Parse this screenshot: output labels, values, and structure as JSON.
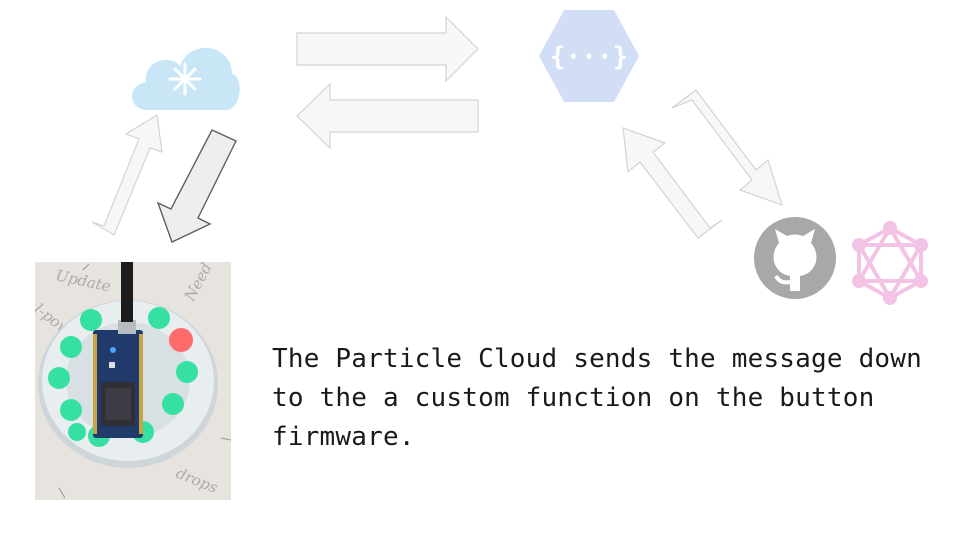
{
  "slide": {
    "caption": "The Particle Cloud sends the message down to the a custom function on the button firmware."
  },
  "icons": {
    "cloud": "particle-cloud-icon",
    "function": "cloud-functions-icon",
    "github": "github-icon",
    "graph": "graphql-icon"
  },
  "colors": {
    "cloud": "#c9e6f7",
    "function": "#d2def6",
    "github": "#a8a8a8",
    "graph": "#f2c3e4",
    "arrow_fill": "#f7f7f7",
    "arrow_stroke": "#d4d4d4",
    "arrow_active_fill": "#eeeeee",
    "arrow_active_stroke": "#5f5f5f",
    "led": "#35e0a2",
    "led_active": "#ff6b6b"
  },
  "photo": {
    "handwriting": [
      "Update",
      "l-power",
      "Need",
      "drops"
    ]
  }
}
